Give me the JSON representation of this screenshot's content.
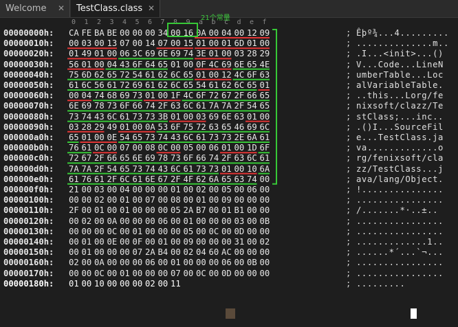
{
  "tabs": [
    {
      "label": "Welcome",
      "active": false,
      "close": "✕"
    },
    {
      "label": "TestClass.class",
      "active": true,
      "close": "✕"
    }
  ],
  "column_header": [
    "0",
    "1",
    "2",
    "3",
    "4",
    "5",
    "6",
    "7",
    "8",
    "9",
    "a",
    "b",
    "c",
    "d",
    "e",
    "f"
  ],
  "annotation": "21个常量",
  "rows": [
    {
      "addr": "00000000h:",
      "bytes": [
        "CA",
        "FE",
        "BA",
        "BE",
        "00",
        "00",
        "00",
        "34",
        "00",
        "16",
        "0A",
        "00",
        "04",
        "00",
        "12",
        "09"
      ],
      "ascii": "Êþº¾...4........."
    },
    {
      "addr": "00000010h:",
      "bytes": [
        "00",
        "03",
        "00",
        "13",
        "07",
        "00",
        "14",
        "07",
        "00",
        "15",
        "01",
        "00",
        "01",
        "6D",
        "01",
        "00"
      ],
      "ascii": "..............m.."
    },
    {
      "addr": "00000020h:",
      "bytes": [
        "01",
        "49",
        "01",
        "00",
        "06",
        "3C",
        "69",
        "6E",
        "69",
        "74",
        "3E",
        "01",
        "00",
        "03",
        "28",
        "29"
      ],
      "ascii": ".I...<init>...()"
    },
    {
      "addr": "00000030h:",
      "bytes": [
        "56",
        "01",
        "00",
        "04",
        "43",
        "6F",
        "64",
        "65",
        "01",
        "00",
        "0F",
        "4C",
        "69",
        "6E",
        "65",
        "4E"
      ],
      "ascii": "V...Code...LineN"
    },
    {
      "addr": "00000040h:",
      "bytes": [
        "75",
        "6D",
        "62",
        "65",
        "72",
        "54",
        "61",
        "62",
        "6C",
        "65",
        "01",
        "00",
        "12",
        "4C",
        "6F",
        "63"
      ],
      "ascii": "umberTable...Loc"
    },
    {
      "addr": "00000050h:",
      "bytes": [
        "61",
        "6C",
        "56",
        "61",
        "72",
        "69",
        "61",
        "62",
        "6C",
        "65",
        "54",
        "61",
        "62",
        "6C",
        "65",
        "01"
      ],
      "ascii": "alVariableTable."
    },
    {
      "addr": "00000060h:",
      "bytes": [
        "00",
        "04",
        "74",
        "68",
        "69",
        "73",
        "01",
        "00",
        "1F",
        "4C",
        "6F",
        "72",
        "67",
        "2F",
        "66",
        "65"
      ],
      "ascii": "..this...Lorg/fe"
    },
    {
      "addr": "00000070h:",
      "bytes": [
        "6E",
        "69",
        "78",
        "73",
        "6F",
        "66",
        "74",
        "2F",
        "63",
        "6C",
        "61",
        "7A",
        "7A",
        "2F",
        "54",
        "65"
      ],
      "ascii": "nixsoft/clazz/Te"
    },
    {
      "addr": "00000080h:",
      "bytes": [
        "73",
        "74",
        "43",
        "6C",
        "61",
        "73",
        "73",
        "3B",
        "01",
        "00",
        "03",
        "69",
        "6E",
        "63",
        "01",
        "00"
      ],
      "ascii": "stClass;...inc.."
    },
    {
      "addr": "00000090h:",
      "bytes": [
        "03",
        "28",
        "29",
        "49",
        "01",
        "00",
        "0A",
        "53",
        "6F",
        "75",
        "72",
        "63",
        "65",
        "46",
        "69",
        "6C"
      ],
      "ascii": ".()I...SourceFil"
    },
    {
      "addr": "000000a0h:",
      "bytes": [
        "65",
        "01",
        "00",
        "0E",
        "54",
        "65",
        "73",
        "74",
        "43",
        "6C",
        "61",
        "73",
        "73",
        "2E",
        "6A",
        "61"
      ],
      "ascii": "e...TestClass.ja"
    },
    {
      "addr": "000000b0h:",
      "bytes": [
        "76",
        "61",
        "0C",
        "00",
        "07",
        "00",
        "08",
        "0C",
        "00",
        "05",
        "00",
        "06",
        "01",
        "00",
        "1D",
        "6F"
      ],
      "ascii": "va.............o"
    },
    {
      "addr": "000000c0h:",
      "bytes": [
        "72",
        "67",
        "2F",
        "66",
        "65",
        "6E",
        "69",
        "78",
        "73",
        "6F",
        "66",
        "74",
        "2F",
        "63",
        "6C",
        "61"
      ],
      "ascii": "rg/fenixsoft/cla"
    },
    {
      "addr": "000000d0h:",
      "bytes": [
        "7A",
        "7A",
        "2F",
        "54",
        "65",
        "73",
        "74",
        "43",
        "6C",
        "61",
        "73",
        "73",
        "01",
        "00",
        "10",
        "6A"
      ],
      "ascii": "zz/TestClass...j"
    },
    {
      "addr": "000000e0h:",
      "bytes": [
        "61",
        "76",
        "61",
        "2F",
        "6C",
        "61",
        "6E",
        "67",
        "2F",
        "4F",
        "62",
        "6A",
        "65",
        "63",
        "74",
        "00"
      ],
      "ascii": "ava/lang/Object."
    },
    {
      "addr": "000000f0h:",
      "bytes": [
        "21",
        "00",
        "03",
        "00",
        "04",
        "00",
        "00",
        "00",
        "01",
        "00",
        "02",
        "00",
        "05",
        "00",
        "06",
        "00"
      ],
      "ascii": "!..............."
    },
    {
      "addr": "00000100h:",
      "bytes": [
        "00",
        "00",
        "02",
        "00",
        "01",
        "00",
        "07",
        "00",
        "08",
        "00",
        "01",
        "00",
        "09",
        "00",
        "00",
        "00"
      ],
      "ascii": "................"
    },
    {
      "addr": "00000110h:",
      "bytes": [
        "2F",
        "00",
        "01",
        "00",
        "01",
        "00",
        "00",
        "00",
        "05",
        "2A",
        "B7",
        "00",
        "01",
        "B1",
        "00",
        "00"
      ],
      "ascii": "/.......*·..±.."
    },
    {
      "addr": "00000120h:",
      "bytes": [
        "00",
        "02",
        "00",
        "0A",
        "00",
        "00",
        "00",
        "06",
        "00",
        "01",
        "00",
        "00",
        "00",
        "03",
        "00",
        "0B"
      ],
      "ascii": "................"
    },
    {
      "addr": "00000130h:",
      "bytes": [
        "00",
        "00",
        "00",
        "0C",
        "00",
        "01",
        "00",
        "00",
        "00",
        "05",
        "00",
        "0C",
        "00",
        "0D",
        "00",
        "00"
      ],
      "ascii": "................"
    },
    {
      "addr": "00000140h:",
      "bytes": [
        "00",
        "01",
        "00",
        "0E",
        "00",
        "0F",
        "00",
        "01",
        "00",
        "09",
        "00",
        "00",
        "00",
        "31",
        "00",
        "02"
      ],
      "ascii": ".............1.."
    },
    {
      "addr": "00000150h:",
      "bytes": [
        "00",
        "01",
        "00",
        "00",
        "00",
        "07",
        "2A",
        "B4",
        "00",
        "02",
        "04",
        "60",
        "AC",
        "00",
        "00",
        "00"
      ],
      "ascii": "......*´...`¬..."
    },
    {
      "addr": "00000160h:",
      "bytes": [
        "02",
        "00",
        "0A",
        "00",
        "00",
        "00",
        "06",
        "00",
        "01",
        "00",
        "00",
        "00",
        "06",
        "00",
        "0B",
        "00"
      ],
      "ascii": "................"
    },
    {
      "addr": "00000170h:",
      "bytes": [
        "00",
        "00",
        "0C",
        "00",
        "01",
        "00",
        "00",
        "00",
        "07",
        "00",
        "0C",
        "00",
        "0D",
        "00",
        "00",
        "00"
      ],
      "ascii": "................"
    },
    {
      "addr": "00000180h:",
      "bytes": [
        "01",
        "00",
        "10",
        "00",
        "00",
        "00",
        "02",
        "00",
        "11"
      ],
      "ascii": "........."
    }
  ]
}
